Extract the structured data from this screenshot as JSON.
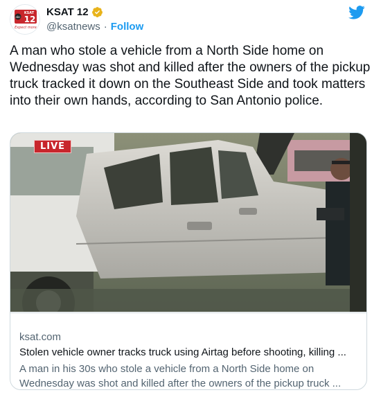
{
  "author": {
    "display_name": "KSAT 12",
    "handle": "@ksatnews",
    "separator": "·",
    "follow_label": "Follow",
    "avatar_text_top": "KSAT",
    "avatar_text_big": "12",
    "avatar_text_abc": "abc",
    "avatar_tagline": "Expect more",
    "brand_color": "#c8262c"
  },
  "tweet": {
    "text": "A man who stole a vehicle from a North Side home on Wednesday was shot and killed after the owners of the pickup truck tracked it down on the Southeast Side and took matters into their own hands, according to San Antonio police."
  },
  "card": {
    "live_label": "LIVE",
    "domain": "ksat.com",
    "title": "Stolen vehicle owner tracks truck using Airtag before shooting, killing ...",
    "description": "A man in his 30s who stole a vehicle from a North Side home on Wednesday was shot and killed after the owners of the pickup truck ..."
  },
  "colors": {
    "twitter_blue": "#1d9bf0",
    "text_primary": "#0f1419",
    "text_secondary": "#536471",
    "border": "#cfd9de"
  },
  "icons": {
    "verified": "verified-badge-icon",
    "logo": "twitter-bird-icon"
  }
}
